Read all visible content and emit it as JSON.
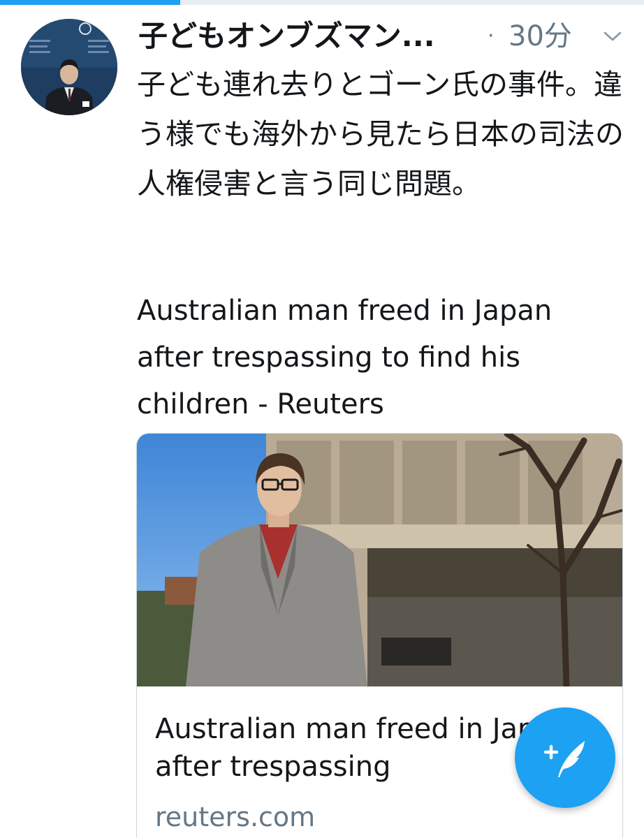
{
  "top_progress": {
    "fraction": 0.28
  },
  "tweet": {
    "display_name": "子どもオンブズマン...",
    "separator": "·",
    "time_ago": "30分",
    "text": "子ども連れ去りとゴーン氏の事件。違う様でも海外から見たら日本の司法の人権侵害と言う同じ問題。",
    "link_text": "Australian man freed in Japan after trespassing to find his children - Reuters"
  },
  "card": {
    "title": "Australian man freed in Japan after trespassing",
    "domain": "reuters.com"
  },
  "icons": {
    "caret": "chevron-down-icon",
    "compose": "compose-tweet-icon"
  },
  "colors": {
    "accent": "#1da1f2",
    "text": "#14171a",
    "secondary": "#657786"
  }
}
